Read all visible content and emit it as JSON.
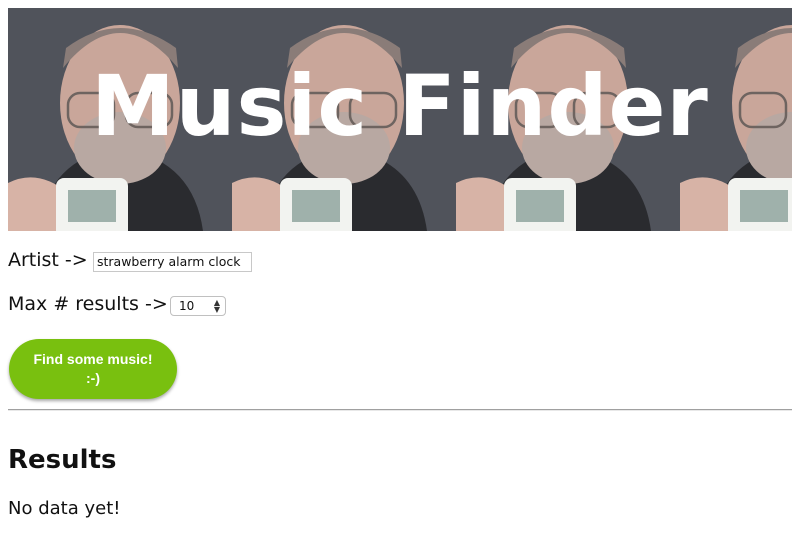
{
  "header": {
    "title": "Music Finder"
  },
  "form": {
    "artist_label": "Artist ->",
    "artist_value": "strawberry alarm clock",
    "max_results_label": "Max # results ->",
    "max_results_value": "10",
    "submit_label": "Find some music!\n:-)"
  },
  "results": {
    "heading": "Results",
    "message": "No data yet!"
  },
  "colors": {
    "button": "#79c00f",
    "banner_background": "#4d5057"
  }
}
